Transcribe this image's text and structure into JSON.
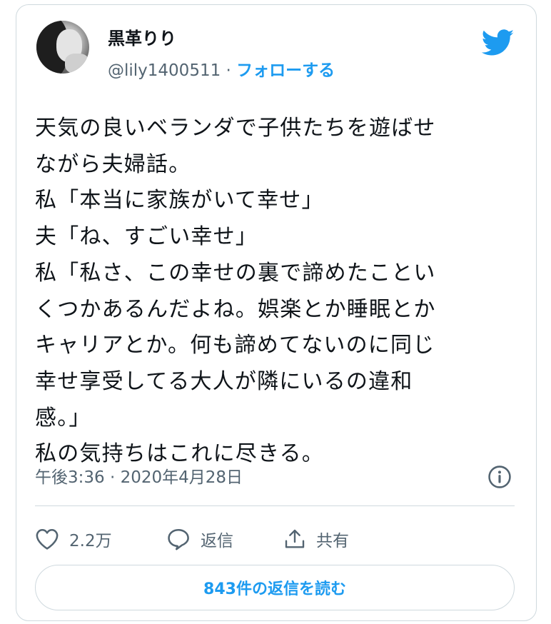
{
  "author": {
    "name": "黒革りり",
    "handle": "@lily1400511",
    "separator": " · ",
    "follow_label": "フォローする"
  },
  "tweet": {
    "text": "天気の良いベランダで子供たちを遊ばせ\nながら夫婦話。\n私「本当に家族がいて幸せ」\n夫「ね、すごい幸せ」\n私「私さ、この幸せの裏で諦めたことい\nくつかあるんだよね。娯楽とか睡眠とか\nキャリアとか。何も諦めてないのに同じ\n幸せ享受してる大人が隣にいるの違和\n感。」\n私の気持ちはこれに尽きる。",
    "timestamp": "午後3:36 · 2020年4月28日"
  },
  "actions": {
    "like_count": "2.2万",
    "reply_label": "返信",
    "share_label": "共有"
  },
  "read_replies_label": "843件の返信を読む",
  "colors": {
    "accent": "#1d9bf0",
    "secondary_text": "#536471",
    "border": "#cfd9de"
  },
  "icons": [
    "twitter-bird-icon",
    "info-icon",
    "heart-icon",
    "reply-icon",
    "share-icon"
  ]
}
